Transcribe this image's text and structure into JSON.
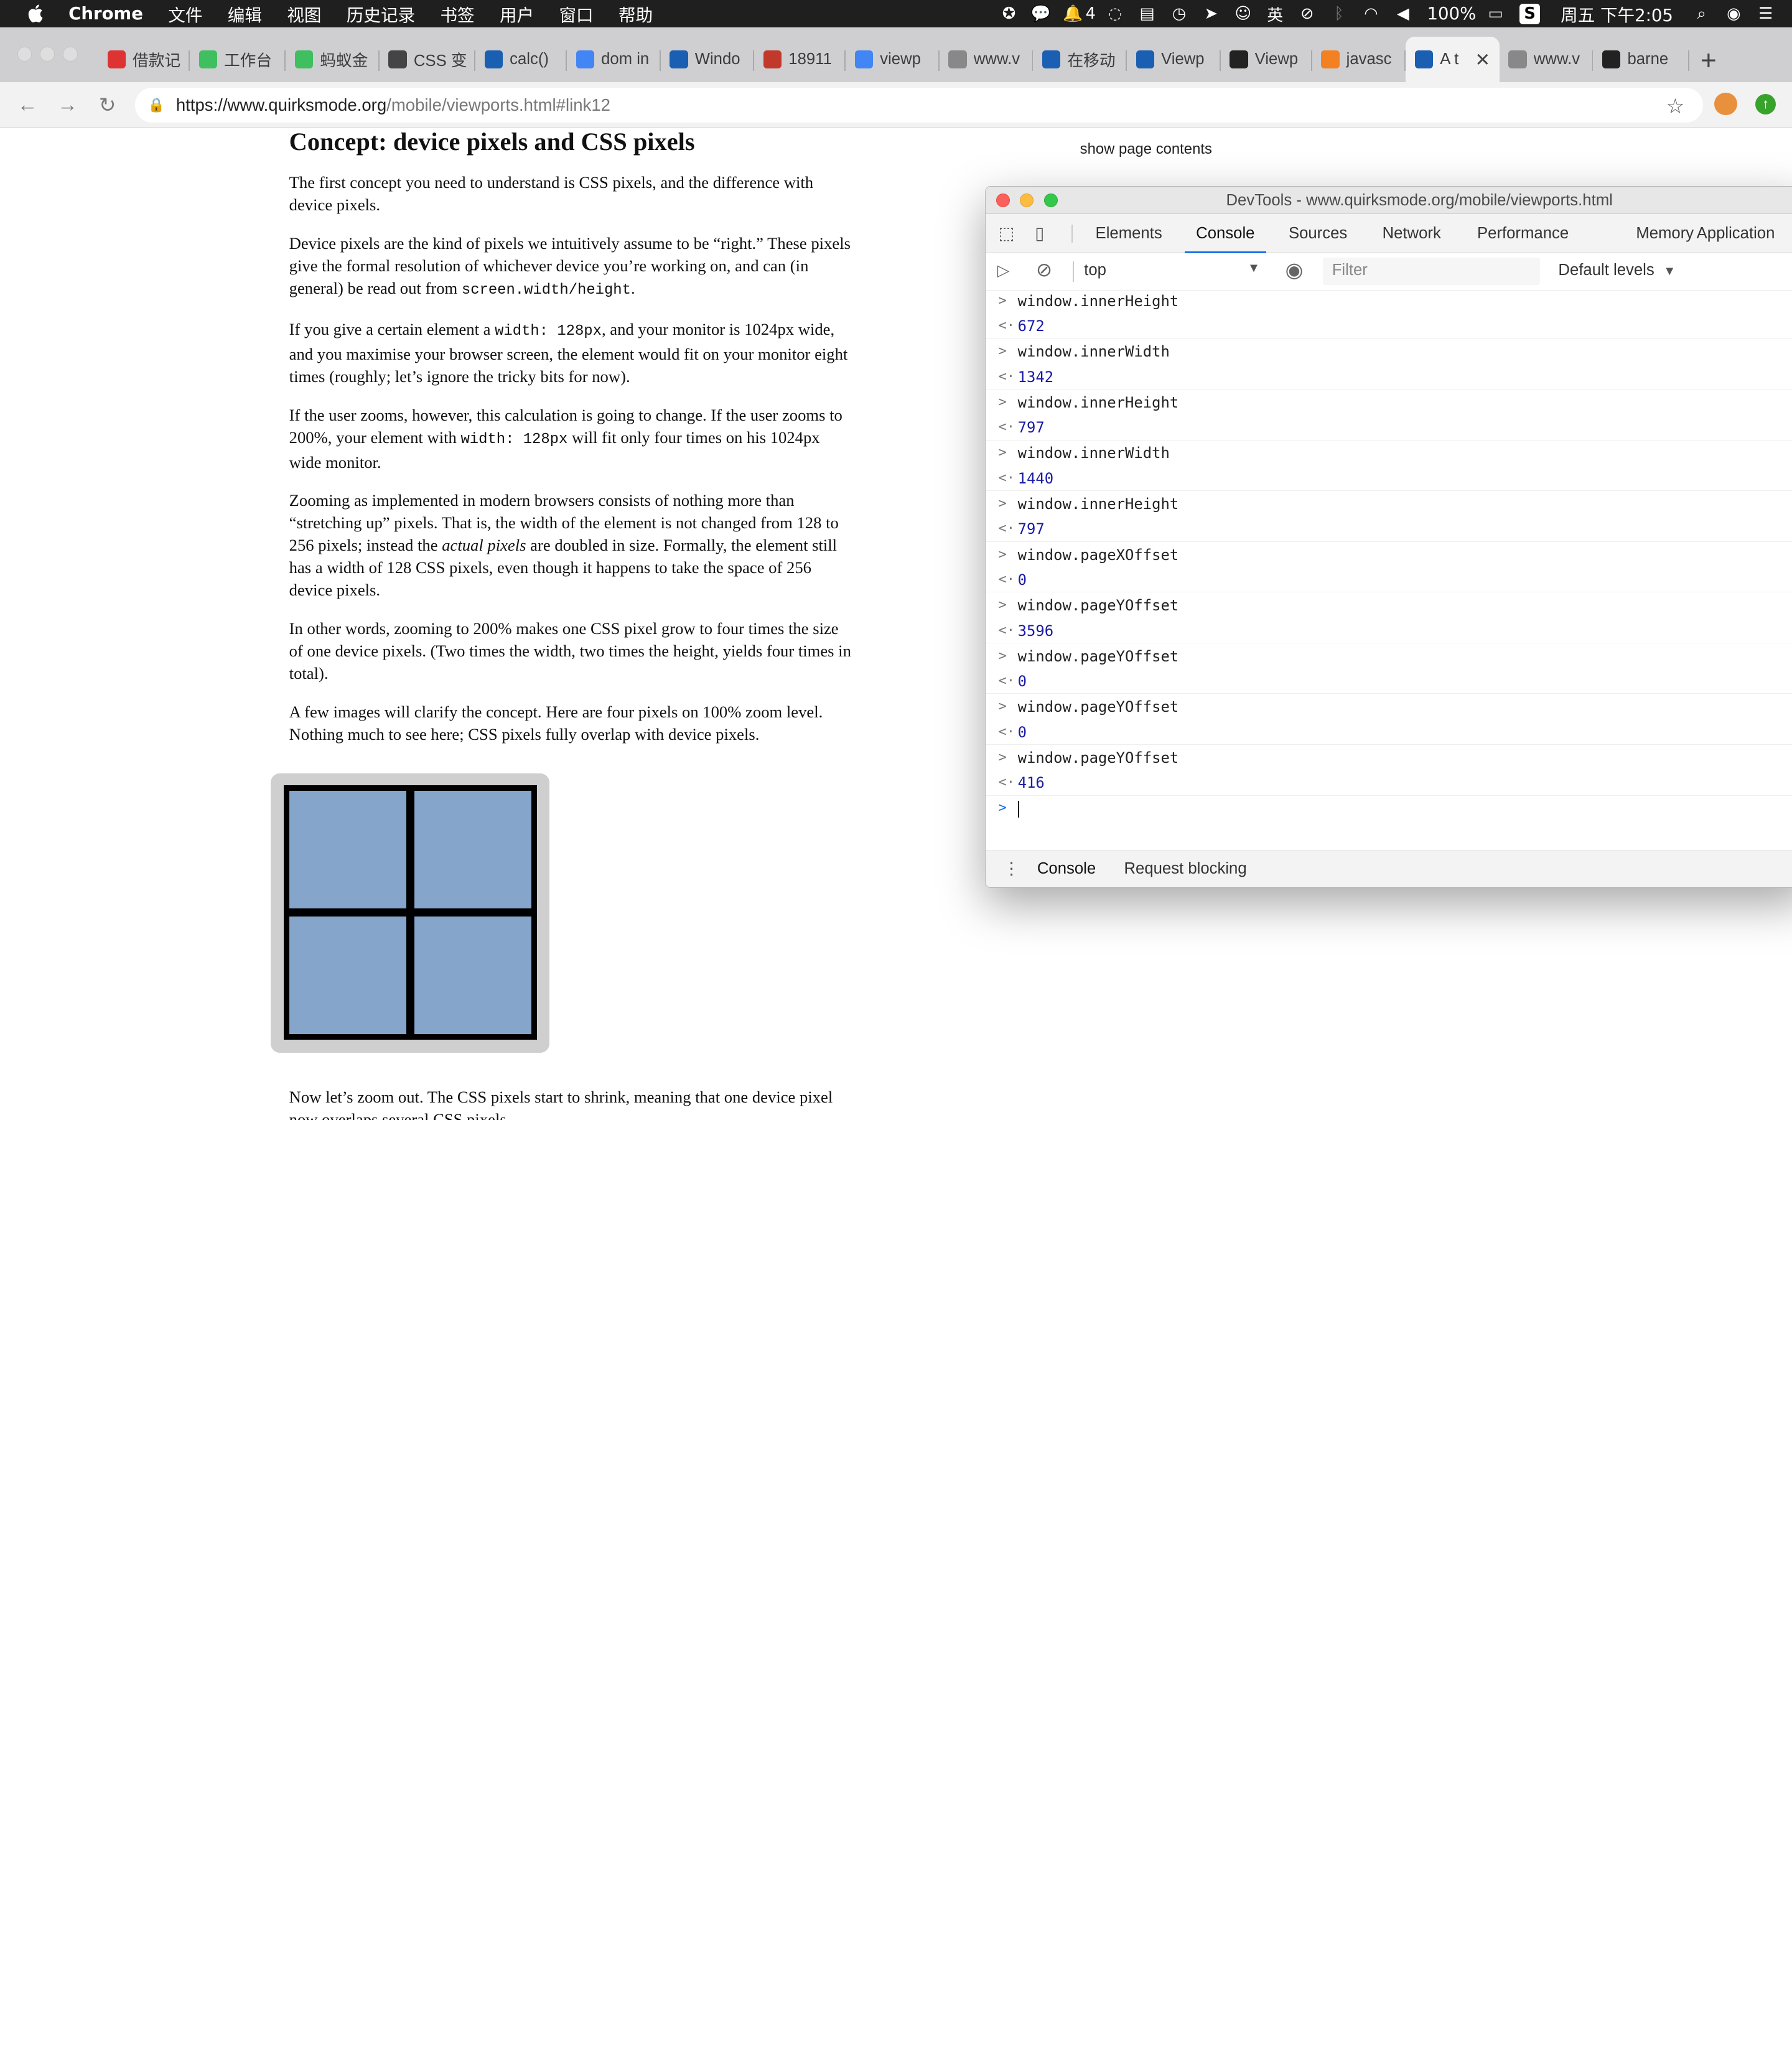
{
  "menubar": {
    "app": "Chrome",
    "items": [
      "文件",
      "编辑",
      "视图",
      "历史记录",
      "书签",
      "用户",
      "窗口",
      "帮助"
    ],
    "notification_count": "4",
    "input_method": "英",
    "battery": "100%",
    "clock": "周五 下午2:05"
  },
  "tabs": [
    {
      "label": "借款记",
      "icon": "angular-icon",
      "color": "#dd3333"
    },
    {
      "label": "工作台",
      "icon": "leaf-icon",
      "color": "#3fbf5f"
    },
    {
      "label": "蚂蚁金",
      "icon": "leaf-icon",
      "color": "#3fbf5f"
    },
    {
      "label": "CSS 变",
      "icon": "brush-icon",
      "color": "#444444"
    },
    {
      "label": "calc()",
      "icon": "mdn-icon",
      "color": "#1b5fb3"
    },
    {
      "label": "dom in",
      "icon": "google-icon",
      "color": "#4285f4"
    },
    {
      "label": "Windo",
      "icon": "mdn-icon",
      "color": "#1b5fb3"
    },
    {
      "label": "18911",
      "icon": "bug-icon",
      "color": "#c0392b"
    },
    {
      "label": "viewp",
      "icon": "google-icon",
      "color": "#4285f4"
    },
    {
      "label": "www.v",
      "icon": "page-icon",
      "color": "#888888"
    },
    {
      "label": "在移动",
      "icon": "mdn-icon",
      "color": "#1b5fb3"
    },
    {
      "label": "Viewp",
      "icon": "mdn-icon",
      "color": "#1b5fb3"
    },
    {
      "label": "Viewp",
      "icon": "wikipedia-icon",
      "color": "#222222"
    },
    {
      "label": "javasc",
      "icon": "stackoverflow-icon",
      "color": "#f48024"
    },
    {
      "label": "A t",
      "icon": "quirksmode-icon",
      "color": "#1b5fb3",
      "active": true
    },
    {
      "label": "www.v",
      "icon": "page-icon",
      "color": "#888888"
    },
    {
      "label": "barne",
      "icon": "github-icon",
      "color": "#222222"
    }
  ],
  "omnibox": {
    "url_host": "https://www.quirksmode.org",
    "url_path": "/mobile/viewports.html#link12"
  },
  "article": {
    "heading": "Concept: device pixels and CSS pixels",
    "show_contents": "show page contents",
    "p1": "The first concept you need to understand is CSS pixels, and the difference with device pixels.",
    "p2_a": "Device pixels are the kind of pixels we intuitively assume to be “right.” These pixels give the formal resolution of whichever device you’re working on, and can (in general) be read out from ",
    "p2_code": "screen.width/height",
    "p2_b": ".",
    "p3_a": "If you give a certain element a ",
    "p3_code": "width: 128px",
    "p3_b": ", and your monitor is 1024px wide, and you maximise your browser screen, the element would fit on your monitor eight times (roughly; let’s ignore the tricky bits for now).",
    "p4_a": "If the user zooms, however, this calculation is going to change. If the user zooms to 200%, your element with ",
    "p4_code": "width: 128px",
    "p4_b": " will fit only four times on his 1024px wide monitor.",
    "p5_a": "Zooming as implemented in modern browsers consists of nothing more than “stretching up” pixels. That is, the width of the element is not changed from 128 to 256 pixels; instead the ",
    "p5_em": "actual pixels",
    "p5_b": " are doubled in size. Formally, the element still has a width of 128 CSS pixels, even though it happens to take the space of 256 device pixels.",
    "p6": "In other words, zooming to 200% makes one CSS pixel grow to four times the size of one device pixels. (Two times the width, two times the height, yields four times in total).",
    "p7": "A few images will clarify the concept. Here are four pixels on 100% zoom level. Nothing much to see here; CSS pixels fully overlap with device pixels.",
    "p8": "Now let’s zoom out. The CSS pixels start to shrink, meaning that one device pixel now overlaps several CSS pixels."
  },
  "devtools": {
    "title": "DevTools - www.quirksmode.org/mobile/viewports.html",
    "tabs": [
      "Elements",
      "Console",
      "Sources",
      "Network",
      "Performance",
      "Memory",
      "Application"
    ],
    "active_tab": "Console",
    "context": "top",
    "filter_placeholder": "Filter",
    "levels": "Default levels",
    "log": [
      {
        "in": "window.innerHeight",
        "out": "672"
      },
      {
        "in": "window.innerWidth",
        "out": "1342"
      },
      {
        "in": "window.innerHeight",
        "out": "797"
      },
      {
        "in": "window.innerWidth",
        "out": "1440"
      },
      {
        "in": "window.innerHeight",
        "out": "797"
      },
      {
        "in": "window.pageXOffset",
        "out": "0"
      },
      {
        "in": "window.pageYOffset",
        "out": "3596"
      },
      {
        "in": "window.pageYOffset",
        "out": "0"
      },
      {
        "in": "window.pageYOffset",
        "out": "0"
      },
      {
        "in": "window.pageYOffset",
        "out": "416"
      }
    ],
    "drawer_tabs": [
      "Console",
      "Request blocking"
    ]
  }
}
